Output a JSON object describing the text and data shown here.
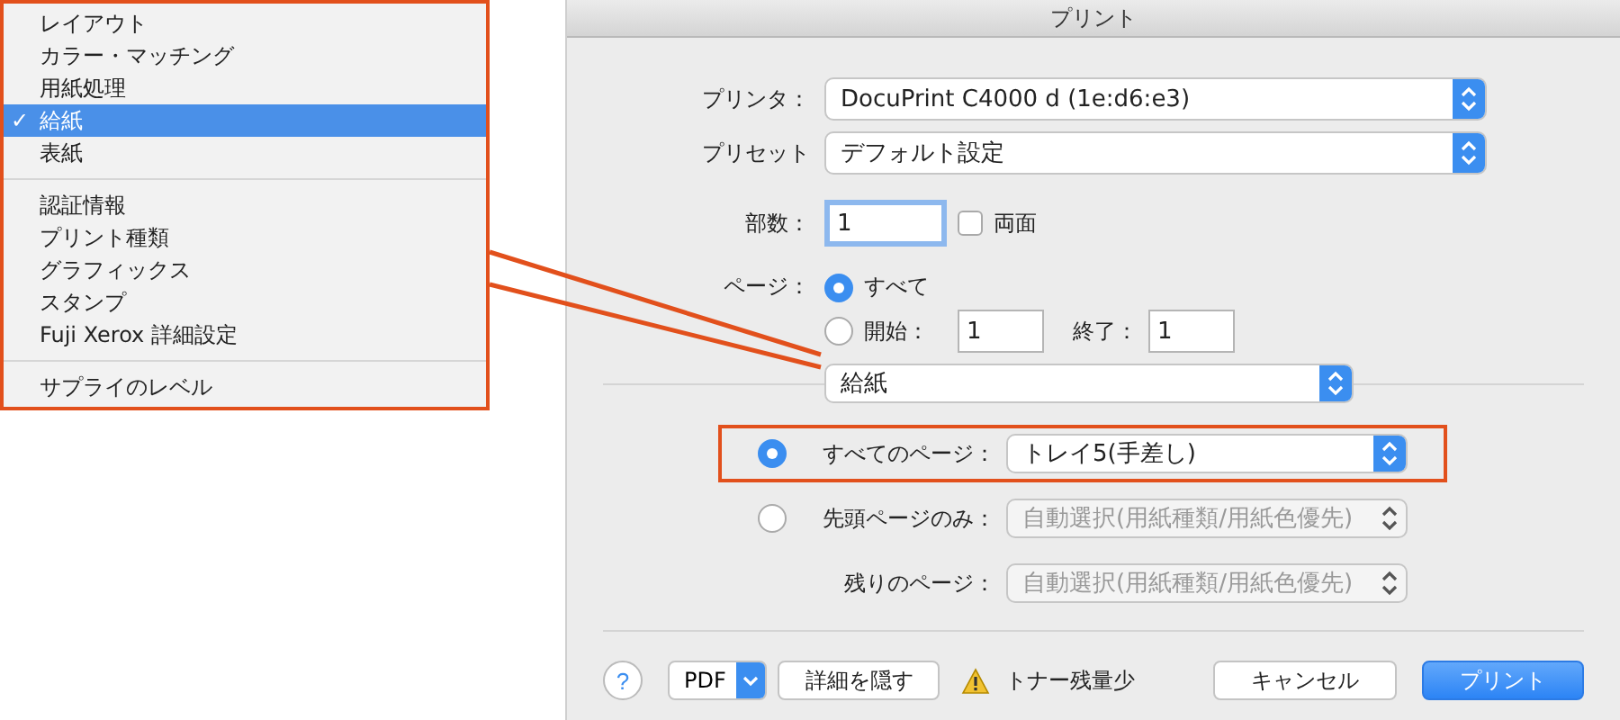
{
  "menu": {
    "check": "✓",
    "groups": [
      [
        {
          "label": "レイアウト",
          "selected": false
        },
        {
          "label": "カラー・マッチング",
          "selected": false
        },
        {
          "label": "用紙処理",
          "selected": false
        },
        {
          "label": "給紙",
          "selected": true
        },
        {
          "label": "表紙",
          "selected": false
        }
      ],
      [
        {
          "label": "認証情報",
          "selected": false
        },
        {
          "label": "プリント種類",
          "selected": false
        },
        {
          "label": "グラフィックス",
          "selected": false
        },
        {
          "label": "スタンプ",
          "selected": false
        },
        {
          "label": "Fuji Xerox 詳細設定",
          "selected": false
        }
      ],
      [
        {
          "label": "サプライのレベル",
          "selected": false
        }
      ]
    ]
  },
  "window": {
    "title": "プリント"
  },
  "printer": {
    "label": "プリンタ：",
    "value": "DocuPrint C4000 d (1e:d6:e3)"
  },
  "preset": {
    "label": "プリセット",
    "value": "デフォルト設定"
  },
  "copies": {
    "label": "部数：",
    "value": "1",
    "duplex": {
      "label": "両面",
      "checked": false
    }
  },
  "pages": {
    "label": "ページ：",
    "options": [
      {
        "kind": "all",
        "label": "すべて",
        "selected": true
      },
      {
        "kind": "range",
        "label": "開始：",
        "selected": false,
        "from": "1",
        "to_label": "終了：",
        "to": "1"
      }
    ]
  },
  "panel": {
    "value": "給紙"
  },
  "paper_source": [
    {
      "kind": "radio",
      "label": "すべてのページ：",
      "selected": true,
      "value": "トレイ5(手差し)",
      "disabled": false,
      "highlighted": true
    },
    {
      "kind": "radio",
      "label": "先頭ページのみ：",
      "selected": false,
      "value": "自動選択(用紙種類/用紙色優先)",
      "disabled": true,
      "highlighted": false
    },
    {
      "kind": "plain",
      "label": "残りのページ：",
      "value": "自動選択(用紙種類/用紙色優先)",
      "disabled": true,
      "highlighted": false
    }
  ],
  "footer": {
    "help": "?",
    "pdf": "PDF",
    "hide_details": "詳細を隠す",
    "warning": "トナー残量少",
    "buttons": [
      {
        "label": "キャンセル",
        "default": false
      },
      {
        "label": "プリント",
        "default": true
      }
    ]
  }
}
